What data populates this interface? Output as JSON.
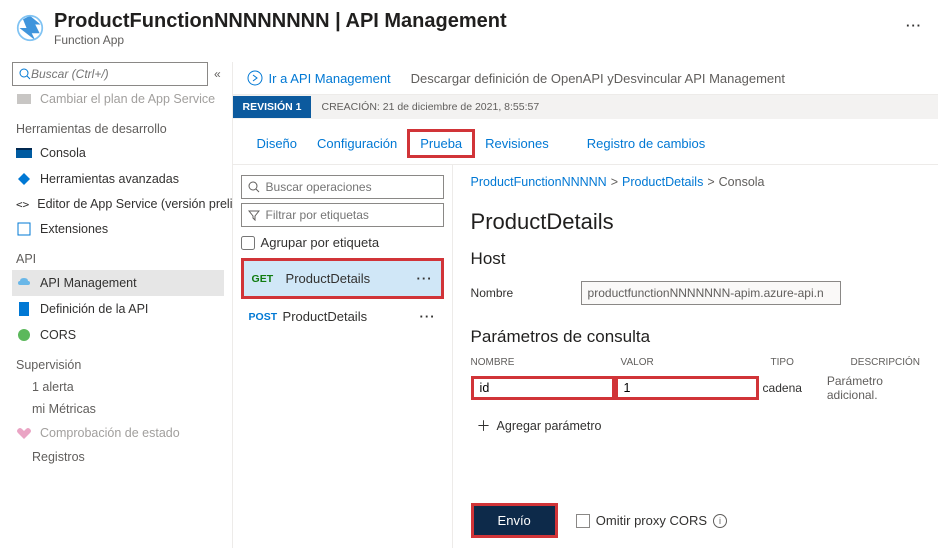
{
  "header": {
    "title": "ProductFunctionNNNNNNNN | API Management",
    "subtitle": "Function App",
    "more": "···"
  },
  "sidebar": {
    "search_placeholder": "Buscar (Ctrl+/)",
    "collapse": "«",
    "plan_item": "Cambiar el plan de App Service",
    "heading_dev": "Herramientas de desarrollo",
    "items_dev": [
      {
        "label": "Consola"
      },
      {
        "label": "Herramientas avanzadas"
      },
      {
        "label": "Editor de App Service (versión preliminar)"
      },
      {
        "label": "Extensiones"
      }
    ],
    "heading_api": "API",
    "items_api": [
      {
        "label": "API Management"
      },
      {
        "label": "Definición de la API"
      },
      {
        "label": "CORS"
      }
    ],
    "heading_mon": "Supervisión",
    "items_mon": [
      {
        "label": "1 alerta"
      },
      {
        "label": "mi Métricas"
      },
      {
        "label": "Comprobación de estado"
      },
      {
        "label": "Registros"
      }
    ]
  },
  "cmdbar": {
    "goto": "Ir a API Management",
    "download": "Descargar definición de OpenAPI yDesvincular API Management"
  },
  "revision": {
    "tab": "REVISIÓN 1",
    "meta": "CREACIÓN: 21 de diciembre de 2021, 8:55:57"
  },
  "tabs": {
    "t1": "Diseño",
    "t2": "Configuración",
    "t3": "Prueba",
    "t4": "Revisiones",
    "t5": "Registro de cambios"
  },
  "ops": {
    "search_ph": "Buscar operaciones",
    "filter_ph": "Filtrar por etiquetas",
    "group": "Agrupar por etiqueta",
    "list": [
      {
        "method": "GET",
        "name": "ProductDetails"
      },
      {
        "method": "POST",
        "name": "ProductDetails"
      }
    ]
  },
  "detail": {
    "crumb1": "ProductFunctionNNNNN",
    "crumb2": "ProductDetails",
    "crumb3": "Consola",
    "title": "ProductDetails",
    "host": "Host",
    "name_label": "Nombre",
    "name_value": "productfunctionNNNNNNN-apim.azure-api.n",
    "params_title": "Parámetros de consulta",
    "cols": {
      "n": "NOMBRE",
      "v": "VALOR",
      "t": "TIPO",
      "d": "DESCRIPCIÓN"
    },
    "row": {
      "name": "id",
      "value": "1",
      "type": "cadena",
      "desc": "Parámetro adicional."
    },
    "add": "Agregar parámetro",
    "send": "Envío",
    "cors": "Omitir proxy CORS",
    "info": "i"
  }
}
